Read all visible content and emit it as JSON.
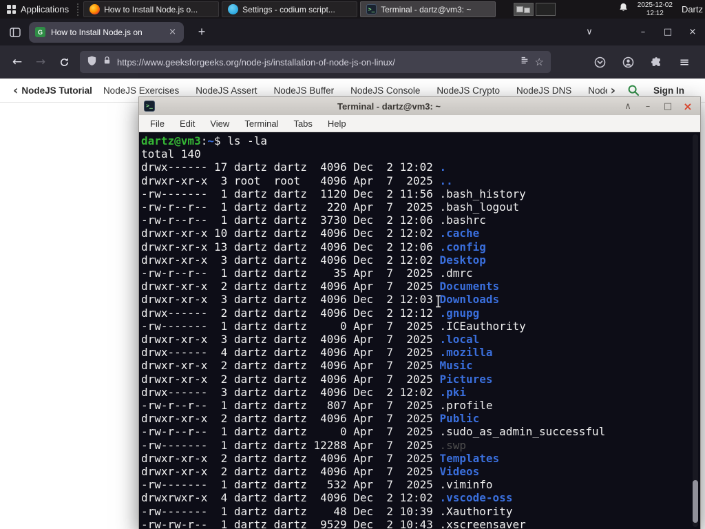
{
  "panel": {
    "applications_label": "Applications",
    "tasks": [
      {
        "title": "How to Install Node.js o...",
        "icon": "firefox",
        "active": false
      },
      {
        "title": "Settings - codium script...",
        "icon": "codium",
        "active": false
      },
      {
        "title": "Terminal - dartz@vm3: ~",
        "icon": "terminal",
        "active": true
      }
    ],
    "clock": {
      "date": "2025-12-02",
      "time": "12:12"
    },
    "user": "Dartz"
  },
  "browser": {
    "tab_title": "How to Install Node.js on",
    "url": "https://www.geeksforgeeks.org/node-js/installation-of-node-js-on-linux/"
  },
  "gfg": {
    "primary": "NodeJS Tutorial",
    "links": [
      "NodeJS Exercises",
      "NodeJS Assert",
      "NodeJS Buffer",
      "NodeJS Console",
      "NodeJS Crypto",
      "NodeJS DNS",
      "Node"
    ],
    "sign_in": "Sign In"
  },
  "terminal": {
    "title": "Terminal - dartz@vm3: ~",
    "menu": [
      "File",
      "Edit",
      "View",
      "Terminal",
      "Tabs",
      "Help"
    ],
    "prompt_user": "dartz@vm3",
    "prompt_sep": ":",
    "prompt_path": "~",
    "prompt_end": "$ ",
    "command": "ls -la",
    "total": "total 140",
    "listing": [
      {
        "pre": "drwx------ 17 dartz dartz  4096 Dec  2 12:02 ",
        "name": ".",
        "type": "dir"
      },
      {
        "pre": "drwxr-xr-x  3 root  root   4096 Apr  7  2025 ",
        "name": "..",
        "type": "dir"
      },
      {
        "pre": "-rw-------  1 dartz dartz  1120 Dec  2 11:56 ",
        "name": ".bash_history",
        "type": "file"
      },
      {
        "pre": "-rw-r--r--  1 dartz dartz   220 Apr  7  2025 ",
        "name": ".bash_logout",
        "type": "file"
      },
      {
        "pre": "-rw-r--r--  1 dartz dartz  3730 Dec  2 12:06 ",
        "name": ".bashrc",
        "type": "file"
      },
      {
        "pre": "drwxr-xr-x 10 dartz dartz  4096 Dec  2 12:02 ",
        "name": ".cache",
        "type": "dir"
      },
      {
        "pre": "drwxr-xr-x 13 dartz dartz  4096 Dec  2 12:06 ",
        "name": ".config",
        "type": "dir"
      },
      {
        "pre": "drwxr-xr-x  3 dartz dartz  4096 Dec  2 12:02 ",
        "name": "Desktop",
        "type": "dir"
      },
      {
        "pre": "-rw-r--r--  1 dartz dartz    35 Apr  7  2025 ",
        "name": ".dmrc",
        "type": "file"
      },
      {
        "pre": "drwxr-xr-x  2 dartz dartz  4096 Apr  7  2025 ",
        "name": "Documents",
        "type": "dir"
      },
      {
        "pre": "drwxr-xr-x  3 dartz dartz  4096 Dec  2 12:03 ",
        "name": "Downloads",
        "type": "dir"
      },
      {
        "pre": "drwx------  2 dartz dartz  4096 Dec  2 12:12 ",
        "name": ".gnupg",
        "type": "dir"
      },
      {
        "pre": "-rw-------  1 dartz dartz     0 Apr  7  2025 ",
        "name": ".ICEauthority",
        "type": "file"
      },
      {
        "pre": "drwxr-xr-x  3 dartz dartz  4096 Apr  7  2025 ",
        "name": ".local",
        "type": "dir"
      },
      {
        "pre": "drwx------  4 dartz dartz  4096 Apr  7  2025 ",
        "name": ".mozilla",
        "type": "dir"
      },
      {
        "pre": "drwxr-xr-x  2 dartz dartz  4096 Apr  7  2025 ",
        "name": "Music",
        "type": "dir"
      },
      {
        "pre": "drwxr-xr-x  2 dartz dartz  4096 Apr  7  2025 ",
        "name": "Pictures",
        "type": "dir"
      },
      {
        "pre": "drwx------  3 dartz dartz  4096 Dec  2 12:02 ",
        "name": ".pki",
        "type": "dir"
      },
      {
        "pre": "-rw-r--r--  1 dartz dartz   807 Apr  7  2025 ",
        "name": ".profile",
        "type": "file"
      },
      {
        "pre": "drwxr-xr-x  2 dartz dartz  4096 Apr  7  2025 ",
        "name": "Public",
        "type": "dir"
      },
      {
        "pre": "-rw-r--r--  1 dartz dartz     0 Apr  7  2025 ",
        "name": ".sudo_as_admin_successful",
        "type": "file"
      },
      {
        "pre": "-rw-------  1 dartz dartz 12288 Apr  7  2025 ",
        "name": ".swp",
        "type": "dim"
      },
      {
        "pre": "drwxr-xr-x  2 dartz dartz  4096 Apr  7  2025 ",
        "name": "Templates",
        "type": "dir"
      },
      {
        "pre": "drwxr-xr-x  2 dartz dartz  4096 Apr  7  2025 ",
        "name": "Videos",
        "type": "dir"
      },
      {
        "pre": "-rw-------  1 dartz dartz   532 Apr  7  2025 ",
        "name": ".viminfo",
        "type": "file"
      },
      {
        "pre": "drwxrwxr-x  4 dartz dartz  4096 Dec  2 12:02 ",
        "name": ".vscode-oss",
        "type": "dir"
      },
      {
        "pre": "-rw-------  1 dartz dartz    48 Dec  2 10:39 ",
        "name": ".Xauthority",
        "type": "file"
      },
      {
        "pre": "-rw-rw-r--  1 dartz dartz  9529 Dec  2 10:43 ",
        "name": ".xscreensaver",
        "type": "file"
      }
    ]
  },
  "icons": {
    "back": "←",
    "forward": "→",
    "new_tab": "+",
    "tab_close": "×",
    "list_tabs": "∨",
    "minimize": "–",
    "maximize": "□",
    "close": "×",
    "star": "☆",
    "menu": "≡",
    "shade": "∧",
    "t_minimize": "–",
    "t_maximize": "□",
    "t_close": "×",
    "chev_left": "‹",
    "chev_right": "›",
    "favicon_letter": "G"
  },
  "colors": {
    "gfg_green": "#2f8d46",
    "dir_blue": "#3a6fdd",
    "prompt_green": "#35b535",
    "terminal_bg": "#0d0d17"
  }
}
